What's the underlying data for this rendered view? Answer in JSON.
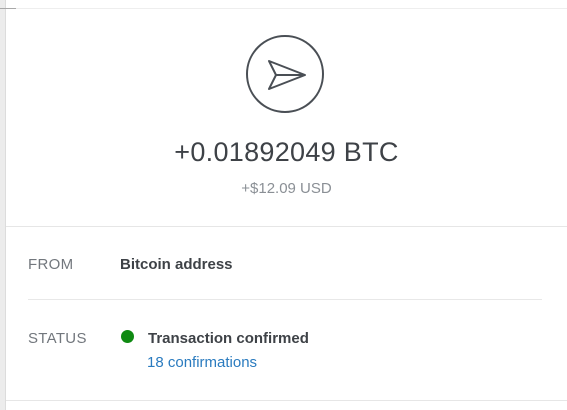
{
  "transaction": {
    "direction_icon": "send-arrow-icon",
    "amount_crypto": "+0.01892049 BTC",
    "amount_fiat": "+$12.09 USD"
  },
  "details": {
    "from_label": "FROM",
    "from_value": "Bitcoin address",
    "status_label": "STATUS",
    "status_value": "Transaction confirmed",
    "status_color": "#0f8a12",
    "confirmations": "18 confirmations",
    "link_color": "#2a7bbf"
  }
}
